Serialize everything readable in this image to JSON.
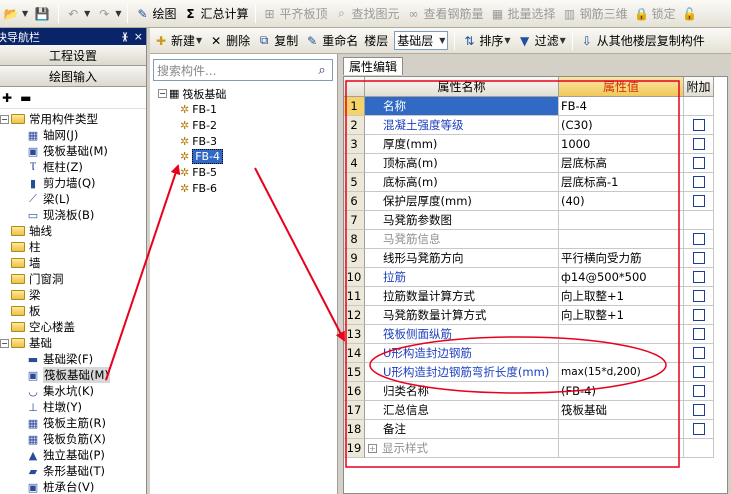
{
  "toolbar1": {
    "draw": "绘图",
    "summary": "汇总计算",
    "flat_top": "平齐板顶",
    "find_elem": "查找图元",
    "view_rebar": "查看钢筋量",
    "batch_select": "批量选择",
    "rebar_3d": "钢筋三维",
    "lock": "锁定"
  },
  "toolbar2": {
    "new": "新建",
    "delete": "删除",
    "copy": "复制",
    "rename": "重命名",
    "floor_label": "楼层",
    "floor_value": "基础层",
    "sort": "排序",
    "filter": "过滤",
    "copy_from_floor": "从其他楼层复制构件"
  },
  "nav": {
    "title": "模块导航栏",
    "pin": "ᚕ",
    "close": "×",
    "project_settings": "工程设置",
    "drawing_input": "绘图输入",
    "tree": [
      {
        "label": "常用构件类型",
        "level": 0,
        "type": "folder",
        "expanded": true
      },
      {
        "label": "轴网(J)",
        "level": 1,
        "type": "item",
        "icon": "axis-grid-icon"
      },
      {
        "label": "筏板基础(M)",
        "level": 1,
        "type": "item",
        "icon": "raft-foundation-icon"
      },
      {
        "label": "框柱(Z)",
        "level": 1,
        "type": "item",
        "icon": "column-icon"
      },
      {
        "label": "剪力墙(Q)",
        "level": 1,
        "type": "item",
        "icon": "shear-wall-icon"
      },
      {
        "label": "梁(L)",
        "level": 1,
        "type": "item",
        "icon": "beam-icon"
      },
      {
        "label": "现浇板(B)",
        "level": 1,
        "type": "item",
        "icon": "slab-icon"
      },
      {
        "label": "轴线",
        "level": 0,
        "type": "folder"
      },
      {
        "label": "柱",
        "level": 0,
        "type": "folder"
      },
      {
        "label": "墙",
        "level": 0,
        "type": "folder"
      },
      {
        "label": "门窗洞",
        "level": 0,
        "type": "folder"
      },
      {
        "label": "梁",
        "level": 0,
        "type": "folder"
      },
      {
        "label": "板",
        "level": 0,
        "type": "folder"
      },
      {
        "label": "空心楼盖",
        "level": 0,
        "type": "folder"
      },
      {
        "label": "基础",
        "level": 0,
        "type": "folder",
        "expanded": true
      },
      {
        "label": "基础梁(F)",
        "level": 1,
        "type": "item",
        "icon": "foundation-beam-icon"
      },
      {
        "label": "筏板基础(M)",
        "level": 1,
        "type": "item",
        "icon": "raft-foundation-icon",
        "selected": true
      },
      {
        "label": "集水坑(K)",
        "level": 1,
        "type": "item",
        "icon": "sump-icon"
      },
      {
        "label": "柱墩(Y)",
        "level": 1,
        "type": "item",
        "icon": "column-pier-icon"
      },
      {
        "label": "筏板主筋(R)",
        "level": 1,
        "type": "item",
        "icon": "raft-main-rebar-icon"
      },
      {
        "label": "筏板负筋(X)",
        "level": 1,
        "type": "item",
        "icon": "raft-neg-rebar-icon"
      },
      {
        "label": "独立基础(P)",
        "level": 1,
        "type": "item",
        "icon": "isolated-footing-icon"
      },
      {
        "label": "条形基础(T)",
        "level": 1,
        "type": "item",
        "icon": "strip-footing-icon"
      },
      {
        "label": "桩承台(V)",
        "level": 1,
        "type": "item",
        "icon": "pile-cap-icon"
      }
    ]
  },
  "middle": {
    "search_placeholder": "搜索构件...",
    "root": "筏板基础",
    "items": [
      "FB-1",
      "FB-2",
      "FB-3",
      "FB-4",
      "FB-5",
      "FB-6"
    ],
    "selected": "FB-4"
  },
  "props": {
    "tab": "属性编辑",
    "col_name": "属性名称",
    "col_value": "属性值",
    "col_attach": "附加",
    "rows": [
      {
        "n": "1",
        "name": "名称",
        "value": "FB-4",
        "style": "blue",
        "check": false,
        "selected": true
      },
      {
        "n": "2",
        "name": "混凝土强度等级",
        "value": "(C30)",
        "style": "blue",
        "check": true
      },
      {
        "n": "3",
        "name": "厚度(mm)",
        "value": "1000",
        "style": "",
        "check": true
      },
      {
        "n": "4",
        "name": "顶标高(m)",
        "value": "层底标高",
        "style": "",
        "check": true
      },
      {
        "n": "5",
        "name": "底标高(m)",
        "value": "层底标高-1",
        "style": "",
        "check": true
      },
      {
        "n": "6",
        "name": "保护层厚度(mm)",
        "value": "(40)",
        "style": "",
        "check": true
      },
      {
        "n": "7",
        "name": "马凳筋参数图",
        "value": "",
        "style": "",
        "check": false
      },
      {
        "n": "8",
        "name": "马凳筋信息",
        "value": "",
        "style": "gray",
        "check": true
      },
      {
        "n": "9",
        "name": "线形马凳筋方向",
        "value": "平行横向受力筋",
        "style": "",
        "check": true
      },
      {
        "n": "10",
        "name": "拉筋",
        "value": "ф14@500*500",
        "style": "blue",
        "check": true
      },
      {
        "n": "11",
        "name": "拉筋数量计算方式",
        "value": "向上取整+1",
        "style": "",
        "check": true
      },
      {
        "n": "12",
        "name": "马凳筋数量计算方式",
        "value": "向上取整+1",
        "style": "",
        "check": true
      },
      {
        "n": "13",
        "name": "筏板侧面纵筋",
        "value": "",
        "style": "blue",
        "check": true
      },
      {
        "n": "14",
        "name": "U形构造封边钢筋",
        "value": "",
        "style": "blue",
        "check": true
      },
      {
        "n": "15",
        "name": "U形构造封边钢筋弯折长度(mm)",
        "value": "max(15*d,200)",
        "style": "blue",
        "check": true
      },
      {
        "n": "16",
        "name": "归类名称",
        "value": "(FB-4)",
        "style": "",
        "check": true
      },
      {
        "n": "17",
        "name": "汇总信息",
        "value": "筏板基础",
        "style": "",
        "check": true
      },
      {
        "n": "18",
        "name": "备注",
        "value": "",
        "style": "",
        "check": true
      },
      {
        "n": "19",
        "name": "显示样式",
        "value": "",
        "style": "gray",
        "check": false,
        "expander": "+"
      }
    ]
  },
  "colors": {
    "annotation_red": "#e8001c",
    "selection_blue": "#316ac5",
    "header_value_bg": "#f5d26a",
    "link_blue": "#1c3fbf"
  }
}
